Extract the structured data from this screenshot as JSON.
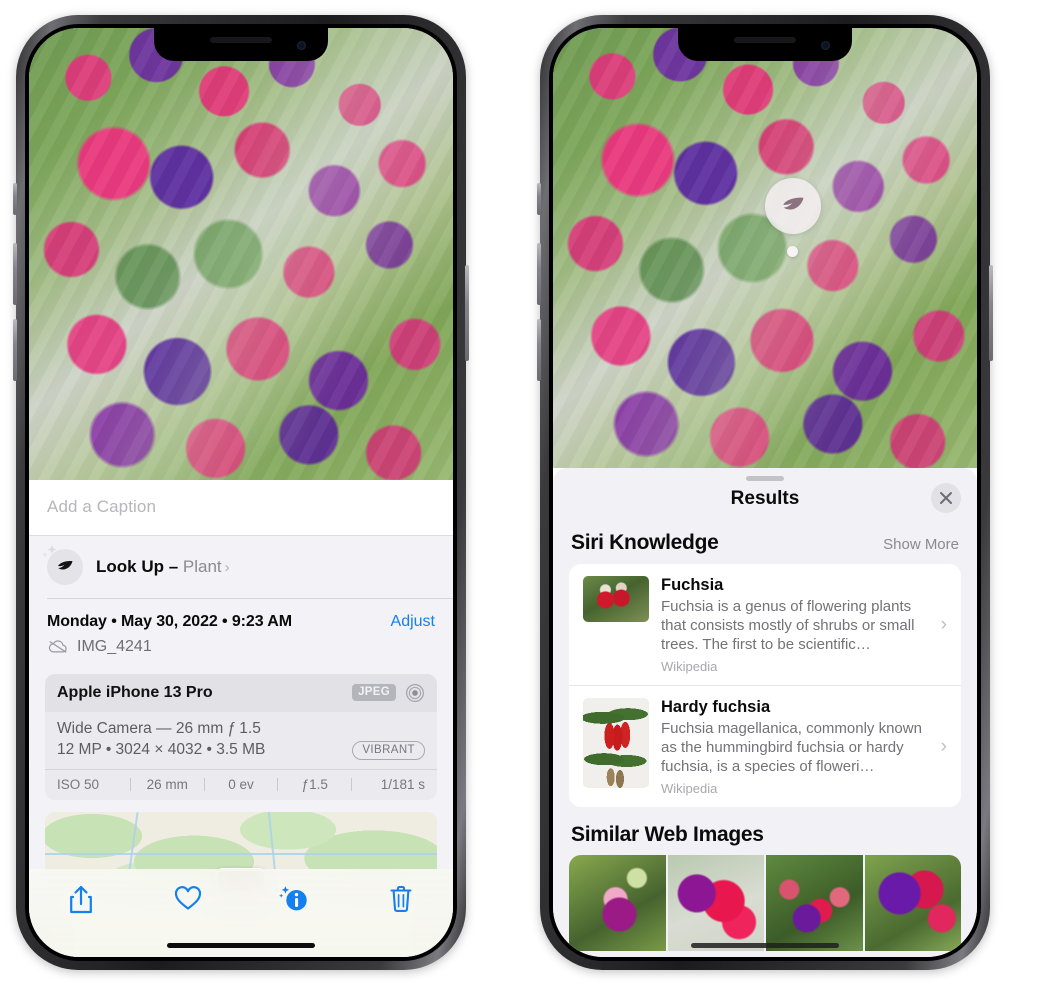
{
  "left_phone": {
    "caption": {
      "placeholder": "Add a Caption",
      "value": ""
    },
    "lookup": {
      "label": "Look Up – ",
      "subject": "Plant",
      "chevron": "›",
      "icon": "leaf-icon"
    },
    "metadata": {
      "datetime": "Monday • May 30, 2022 • 9:23 AM",
      "adjust_label": "Adjust",
      "filename": "IMG_4241",
      "cloud_icon": "icloud-slash-icon"
    },
    "camera_card": {
      "model": "Apple iPhone 13 Pro",
      "format_badge": "JPEG",
      "lens_icon": "lens-circle-icon",
      "lens_line": "Wide Camera — 26 mm ƒ 1.5",
      "specs_line": "12 MP • 3024 × 4032 • 3.5 MB",
      "style_badge": "VIBRANT",
      "exif": [
        "ISO 50",
        "26 mm",
        "0 ev",
        "ƒ1.5",
        "1/181 s"
      ]
    },
    "toolbar": [
      {
        "name": "share-button",
        "icon": "share-icon"
      },
      {
        "name": "favorite-button",
        "icon": "heart-icon"
      },
      {
        "name": "info-button",
        "icon": "info-sparkle-icon"
      },
      {
        "name": "delete-button",
        "icon": "trash-icon"
      }
    ],
    "accent_color": "#1480f0"
  },
  "right_phone": {
    "badge": {
      "icon": "leaf-icon"
    },
    "sheet": {
      "title": "Results",
      "close_icon": "close-icon",
      "grabber": "drag-handle"
    },
    "siri_knowledge": {
      "title": "Siri Knowledge",
      "show_more": "Show More",
      "items": [
        {
          "title": "Fuchsia",
          "snippet": "Fuchsia is a genus of flowering plants that consists mostly of shrubs or small trees. The first to be scientific…",
          "source": "Wikipedia",
          "chevron": "›"
        },
        {
          "title": "Hardy fuchsia",
          "snippet": "Fuchsia magellanica, commonly known as the hummingbird fuchsia or hardy fuchsia, is a species of floweri…",
          "source": "Wikipedia",
          "chevron": "›"
        }
      ]
    },
    "similar_web_images": {
      "title": "Similar Web Images",
      "count": 4
    }
  }
}
